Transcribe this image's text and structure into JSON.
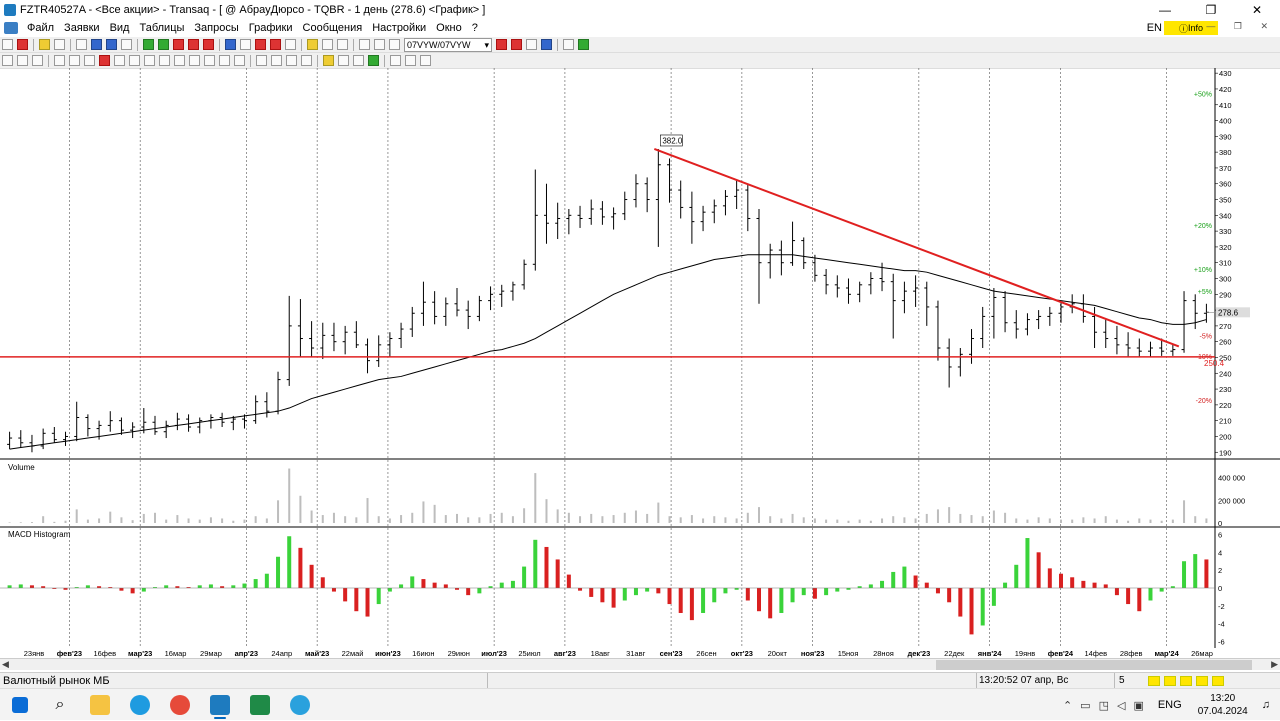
{
  "window": {
    "title": "FZTR40527A - <Все акции> - Transaq - [ @ АбрауДюрсо - TQBR - 1 день (278.6) <График> ]",
    "controls": [
      "—",
      "❐",
      "✕"
    ]
  },
  "menu": {
    "items": [
      "Файл",
      "Заявки",
      "Вид",
      "Таблицы",
      "Запросы",
      "Графики",
      "Сообщения",
      "Настройки",
      "Окно",
      "?"
    ],
    "lang": "EN",
    "info_label": "Info",
    "mdi_controls": "— ❐ ✕"
  },
  "toolbar": {
    "select_value": "07VYW/07VYW"
  },
  "chart_data": {
    "type": "candlestick",
    "price_axis": {
      "ticks": [
        430,
        420,
        410,
        400,
        390,
        380,
        370,
        360,
        350,
        340,
        330,
        320,
        310,
        300,
        290,
        280,
        270,
        260,
        250,
        240,
        230,
        220,
        210,
        200,
        190
      ],
      "range": [
        187,
        432
      ]
    },
    "last_price_label": "278.6",
    "peak_label": "382.0",
    "support_label": "250.4",
    "support_level": 250.4,
    "percent_labels": [
      {
        "text": "+50%",
        "price": 417,
        "color": "#1aa01a"
      },
      {
        "text": "+20%",
        "price": 334,
        "color": "#1aa01a"
      },
      {
        "text": "+10%",
        "price": 306,
        "color": "#1aa01a"
      },
      {
        "text": "+5%",
        "price": 292,
        "color": "#1aa01a"
      },
      {
        "text": "-5%",
        "price": 264,
        "color": "#d22020"
      },
      {
        "text": "-10%",
        "price": 251,
        "color": "#d22020"
      },
      {
        "text": "-20%",
        "price": 223,
        "color": "#d22020"
      }
    ],
    "trendline": {
      "start": {
        "date": "01.08.2023",
        "price": 382
      },
      "end": {
        "date": "27.03.2024",
        "price": 257
      },
      "color": "#e02020"
    },
    "x_axis_labels": [
      "23янв",
      "фев'23",
      "16фев",
      "мар'23",
      "16мар",
      "29мар",
      "апр'23",
      "24апр",
      "май'23",
      "22май",
      "июн'23",
      "16июн",
      "29июн",
      "июл'23",
      "25июл",
      "авг'23",
      "18авг",
      "31авг",
      "сен'23",
      "26сен",
      "окт'23",
      "20окт",
      "ноя'23",
      "15ноя",
      "28ноя",
      "дек'23",
      "22дек",
      "янв'24",
      "19янв",
      "фев'24",
      "14фев",
      "28фев",
      "мар'24",
      "26мар"
    ],
    "candles": [
      [
        195,
        203,
        192,
        199
      ],
      [
        199,
        204,
        193,
        196
      ],
      [
        196,
        201,
        190,
        194
      ],
      [
        194,
        205,
        192,
        202
      ],
      [
        202,
        206,
        196,
        198
      ],
      [
        198,
        203,
        194,
        200
      ],
      [
        200,
        222,
        197,
        212
      ],
      [
        212,
        214,
        200,
        205
      ],
      [
        205,
        210,
        198,
        207
      ],
      [
        207,
        216,
        203,
        210
      ],
      [
        210,
        212,
        201,
        204
      ],
      [
        204,
        209,
        199,
        206
      ],
      [
        206,
        218,
        202,
        209
      ],
      [
        209,
        213,
        201,
        203
      ],
      [
        203,
        210,
        199,
        207
      ],
      [
        207,
        215,
        204,
        211
      ],
      [
        211,
        214,
        203,
        206
      ],
      [
        206,
        212,
        202,
        210
      ],
      [
        210,
        214,
        205,
        212
      ],
      [
        212,
        215,
        206,
        209
      ],
      [
        209,
        213,
        204,
        211
      ],
      [
        211,
        214,
        205,
        210
      ],
      [
        210,
        226,
        208,
        222
      ],
      [
        222,
        228,
        212,
        216
      ],
      [
        216,
        241,
        214,
        236
      ],
      [
        236,
        289,
        232,
        270
      ],
      [
        270,
        287,
        250,
        262
      ],
      [
        262,
        273,
        250,
        256
      ],
      [
        256,
        272,
        249,
        264
      ],
      [
        264,
        272,
        254,
        260
      ],
      [
        260,
        270,
        252,
        266
      ],
      [
        266,
        273,
        256,
        258
      ],
      [
        258,
        262,
        240,
        248
      ],
      [
        248,
        264,
        244,
        258
      ],
      [
        258,
        266,
        250,
        262
      ],
      [
        262,
        272,
        256,
        268
      ],
      [
        268,
        282,
        263,
        278
      ],
      [
        278,
        298,
        270,
        285
      ],
      [
        285,
        292,
        271,
        276
      ],
      [
        276,
        288,
        270,
        284
      ],
      [
        284,
        294,
        276,
        280
      ],
      [
        280,
        286,
        268,
        276
      ],
      [
        276,
        289,
        273,
        286
      ],
      [
        286,
        295,
        280,
        290
      ],
      [
        290,
        296,
        282,
        292
      ],
      [
        292,
        298,
        286,
        296
      ],
      [
        296,
        312,
        293,
        309
      ],
      [
        309,
        369,
        305,
        340
      ],
      [
        340,
        360,
        322,
        335
      ],
      [
        335,
        348,
        325,
        338
      ],
      [
        338,
        344,
        328,
        340
      ],
      [
        340,
        346,
        332,
        338
      ],
      [
        338,
        350,
        334,
        344
      ],
      [
        344,
        349,
        334,
        339
      ],
      [
        339,
        345,
        331,
        341
      ],
      [
        341,
        355,
        337,
        350
      ],
      [
        350,
        366,
        345,
        360
      ],
      [
        360,
        364,
        342,
        350
      ],
      [
        350,
        382,
        320,
        372
      ],
      [
        372,
        376,
        348,
        356
      ],
      [
        356,
        362,
        338,
        345
      ],
      [
        345,
        355,
        322,
        336
      ],
      [
        336,
        346,
        330,
        342
      ],
      [
        342,
        350,
        335,
        346
      ],
      [
        346,
        356,
        340,
        352
      ],
      [
        352,
        362,
        344,
        356
      ],
      [
        356,
        360,
        330,
        338
      ],
      [
        338,
        344,
        284,
        310
      ],
      [
        310,
        322,
        300,
        318
      ],
      [
        318,
        324,
        302,
        310
      ],
      [
        310,
        336,
        308,
        324
      ],
      [
        324,
        326,
        306,
        310
      ],
      [
        310,
        315,
        298,
        302
      ],
      [
        302,
        306,
        290,
        296
      ],
      [
        296,
        302,
        288,
        294
      ],
      [
        294,
        300,
        284,
        290
      ],
      [
        290,
        298,
        285,
        296
      ],
      [
        296,
        304,
        290,
        300
      ],
      [
        300,
        310,
        292,
        298
      ],
      [
        298,
        303,
        262,
        286
      ],
      [
        286,
        298,
        278,
        292
      ],
      [
        292,
        302,
        282,
        294
      ],
      [
        294,
        298,
        270,
        282
      ],
      [
        282,
        286,
        248,
        256
      ],
      [
        256,
        262,
        231,
        244
      ],
      [
        244,
        256,
        238,
        252
      ],
      [
        252,
        268,
        246,
        262
      ],
      [
        262,
        282,
        256,
        276
      ],
      [
        276,
        294,
        262,
        288
      ],
      [
        288,
        292,
        266,
        272
      ],
      [
        272,
        280,
        262,
        268
      ],
      [
        268,
        278,
        264,
        274
      ],
      [
        274,
        280,
        268,
        276
      ],
      [
        276,
        282,
        270,
        278
      ],
      [
        278,
        286,
        272,
        282
      ],
      [
        282,
        290,
        278,
        284
      ],
      [
        284,
        290,
        272,
        276
      ],
      [
        276,
        282,
        256,
        266
      ],
      [
        266,
        274,
        256,
        262
      ],
      [
        262,
        270,
        252,
        258
      ],
      [
        258,
        266,
        250,
        256
      ],
      [
        256,
        262,
        250,
        254
      ],
      [
        254,
        260,
        250,
        256
      ],
      [
        256,
        262,
        251,
        254
      ],
      [
        254,
        258,
        251,
        255
      ],
      [
        255,
        292,
        253,
        286
      ],
      [
        286,
        290,
        268,
        278
      ],
      [
        278,
        284,
        272,
        278.6
      ]
    ],
    "ma": [
      192,
      193,
      194,
      195,
      196,
      197,
      198,
      199,
      200,
      201,
      202,
      203,
      204,
      205,
      206,
      207,
      208,
      209,
      210,
      211,
      212,
      213,
      214,
      215,
      216,
      218,
      221,
      224,
      226,
      228,
      230,
      232,
      234,
      236,
      237,
      238,
      240,
      242,
      244,
      246,
      248,
      250,
      252,
      254,
      255,
      257,
      259,
      262,
      266,
      270,
      274,
      278,
      282,
      286,
      290,
      293,
      296,
      299,
      302,
      304,
      306,
      308,
      310,
      312,
      313,
      314,
      315,
      315,
      315,
      315,
      315,
      314,
      313,
      312,
      311,
      310,
      309,
      308,
      307,
      306,
      305,
      305,
      304,
      302,
      300,
      298,
      296,
      294,
      292,
      291,
      290,
      289,
      288,
      287,
      286,
      285,
      284,
      283,
      281,
      279,
      277,
      275,
      274,
      272,
      271,
      271,
      272,
      274
    ],
    "volume": {
      "axis_labels": [
        "400 000",
        "200 000",
        "0"
      ],
      "range": [
        0,
        520000
      ],
      "values": [
        5000,
        6000,
        8000,
        60000,
        10000,
        20000,
        120000,
        30000,
        40000,
        100000,
        50000,
        25000,
        80000,
        90000,
        30000,
        70000,
        40000,
        30000,
        50000,
        40000,
        20000,
        30000,
        60000,
        40000,
        200000,
        480000,
        240000,
        110000,
        70000,
        90000,
        60000,
        50000,
        220000,
        60000,
        40000,
        70000,
        90000,
        190000,
        160000,
        70000,
        80000,
        50000,
        50000,
        80000,
        90000,
        60000,
        130000,
        440000,
        210000,
        120000,
        90000,
        60000,
        80000,
        60000,
        70000,
        90000,
        110000,
        80000,
        180000,
        60000,
        50000,
        70000,
        40000,
        60000,
        50000,
        40000,
        90000,
        140000,
        60000,
        40000,
        80000,
        50000,
        40000,
        30000,
        30000,
        20000,
        30000,
        20000,
        40000,
        60000,
        50000,
        40000,
        80000,
        120000,
        140000,
        80000,
        70000,
        60000,
        110000,
        90000,
        40000,
        30000,
        50000,
        40000,
        30000,
        30000,
        50000,
        40000,
        60000,
        30000,
        20000,
        40000,
        30000,
        20000,
        30000,
        200000,
        60000,
        40000
      ]
    },
    "macd": {
      "axis_labels": [
        "6",
        "4",
        "2",
        "0",
        "-2",
        "-4",
        "-6"
      ],
      "range": [
        -6.5,
        6.5
      ],
      "values": [
        0.3,
        0.4,
        0.3,
        0.2,
        -0.1,
        -0.2,
        0.1,
        0.3,
        0.2,
        0.1,
        -0.3,
        -0.6,
        -0.4,
        0.1,
        0.3,
        0.2,
        0.1,
        0.3,
        0.4,
        0.2,
        0.3,
        0.5,
        1.0,
        1.6,
        3.5,
        5.8,
        4.5,
        2.6,
        1.2,
        -0.4,
        -1.5,
        -2.6,
        -3.2,
        -1.8,
        -0.4,
        0.4,
        1.3,
        1.0,
        0.6,
        0.4,
        -0.2,
        -0.8,
        -0.6,
        0.2,
        0.6,
        0.8,
        2.4,
        5.4,
        4.6,
        3.2,
        1.5,
        -0.3,
        -1.0,
        -1.6,
        -2.2,
        -1.4,
        -0.8,
        -0.4,
        -0.6,
        -1.8,
        -2.8,
        -3.6,
        -2.8,
        -1.6,
        -0.6,
        -0.2,
        -1.4,
        -2.6,
        -3.4,
        -2.8,
        -1.6,
        -0.8,
        -1.2,
        -0.8,
        -0.4,
        -0.2,
        0.2,
        0.4,
        0.8,
        1.8,
        2.4,
        1.4,
        0.6,
        -0.6,
        -1.6,
        -3.2,
        -5.2,
        -4.2,
        -2.0,
        0.6,
        2.6,
        5.6,
        4.0,
        2.2,
        1.6,
        1.2,
        0.8,
        0.6,
        0.4,
        -0.8,
        -1.8,
        -2.6,
        -1.4,
        -0.4,
        0.2,
        3.0,
        3.8,
        3.2
      ]
    }
  },
  "panels": {
    "volume_label": "Volume",
    "macd_label": "MACD Histogram"
  },
  "status": {
    "market": "Валютный рынок МБ",
    "time": "13:20:52  07 апр, Вс",
    "count": "5"
  },
  "taskbar": {
    "lang": "ENG",
    "clock_time": "13:20",
    "clock_date": "07.04.2024"
  },
  "colors": {
    "bull_bar": "#3ad33a",
    "bear_bar": "#d92020",
    "candle": "#000000",
    "ma_line": "#000000",
    "support_line": "#e02020",
    "grid": "#555555"
  }
}
